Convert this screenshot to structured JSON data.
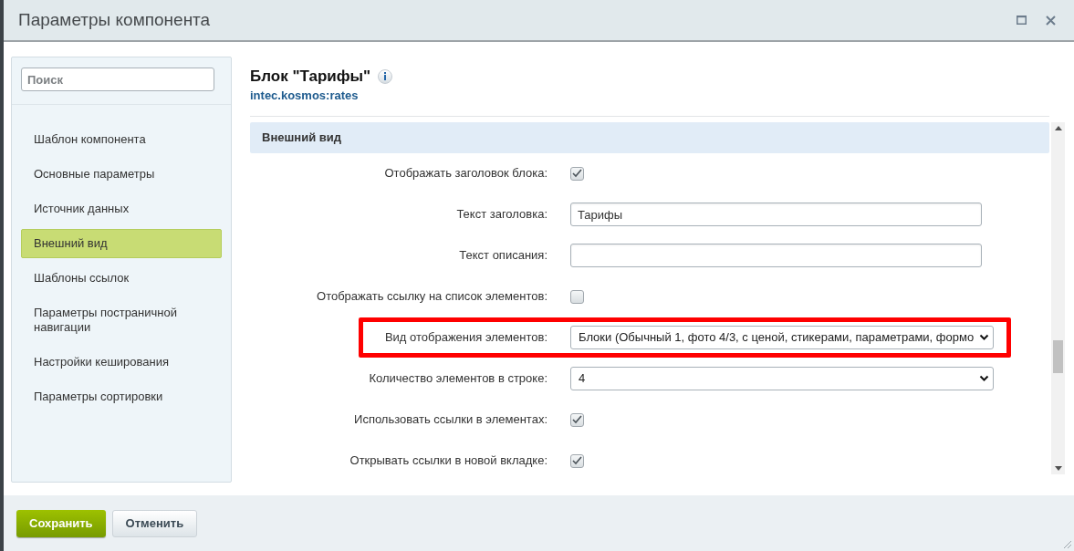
{
  "window": {
    "title": "Параметры компонента"
  },
  "sidebar": {
    "search": {
      "placeholder": "Поиск"
    },
    "items": [
      {
        "label": "Шаблон компонента",
        "selected": false
      },
      {
        "label": "Основные параметры",
        "selected": false
      },
      {
        "label": "Источник данных",
        "selected": false
      },
      {
        "label": "Внешний вид",
        "selected": true
      },
      {
        "label": "Шаблоны ссылок",
        "selected": false
      },
      {
        "label": "Параметры постраничной навигации",
        "selected": false
      },
      {
        "label": "Настройки кеширования",
        "selected": false
      },
      {
        "label": "Параметры сортировки",
        "selected": false
      }
    ]
  },
  "component": {
    "title": "Блок \"Тарифы\"",
    "code": "intec.kosmos:rates"
  },
  "section": {
    "title": "Внешний вид",
    "rows": [
      {
        "kind": "checkbox",
        "label": "Отображать заголовок блока:",
        "checked": true,
        "highlighted": false
      },
      {
        "kind": "text",
        "label": "Текст заголовка:",
        "value": "Тарифы",
        "highlighted": false
      },
      {
        "kind": "text",
        "label": "Текст описания:",
        "value": "",
        "highlighted": false
      },
      {
        "kind": "checkbox",
        "label": "Отображать ссылку на список элементов:",
        "checked": false,
        "highlighted": false
      },
      {
        "kind": "select",
        "label": "Вид отображения элементов:",
        "value": "Блоки (Обычный 1, фото 4/3, с ценой, стикерами, параметрами, формо",
        "highlighted": true
      },
      {
        "kind": "select",
        "label": "Количество элементов в строке:",
        "value": "4",
        "highlighted": false
      },
      {
        "kind": "checkbox",
        "label": "Использовать ссылки в элементах:",
        "checked": true,
        "highlighted": false
      },
      {
        "kind": "checkbox",
        "label": "Открывать ссылки в новой вкладке:",
        "checked": true,
        "highlighted": false
      }
    ]
  },
  "buttons": {
    "save": "Сохранить",
    "cancel": "Отменить"
  }
}
